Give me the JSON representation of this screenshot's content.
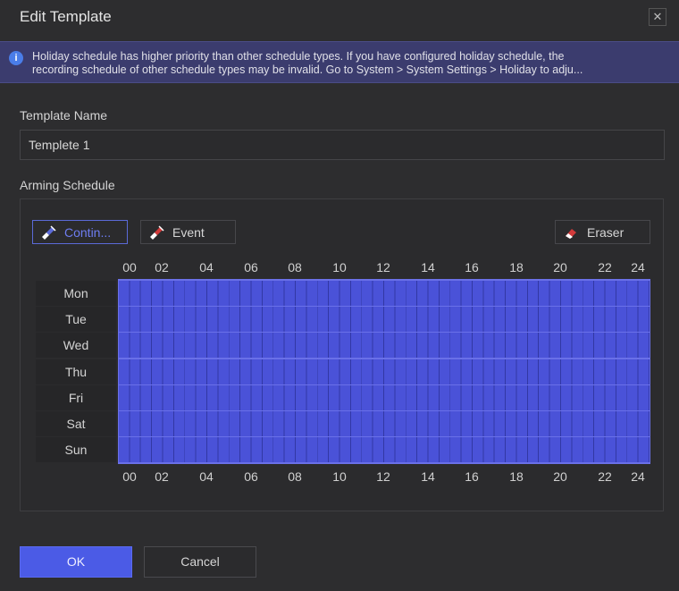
{
  "dialog": {
    "title": "Edit Template",
    "close_glyph": "✕"
  },
  "info": {
    "icon": "i",
    "line1": "Holiday schedule has higher priority than other schedule types. If you have configured holiday schedule, the",
    "line2": "recording schedule of other schedule types may be invalid. Go to System > System Settings > Holiday to adju..."
  },
  "template_name": {
    "label": "Template Name",
    "value": "Templete 1"
  },
  "schedule": {
    "label": "Arming Schedule",
    "tools": {
      "continuous": "Contin...",
      "event": "Event",
      "eraser": "Eraser"
    },
    "hours_top": [
      "00",
      "02",
      "04",
      "06",
      "08",
      "10",
      "12",
      "14",
      "16",
      "18",
      "20",
      "22",
      "24"
    ],
    "hours_bottom": [
      "00",
      "02",
      "04",
      "06",
      "08",
      "10",
      "12",
      "14",
      "16",
      "18",
      "20",
      "22",
      "24"
    ],
    "days": [
      "Mon",
      "Tue",
      "Wed",
      "Thu",
      "Fri",
      "Sat",
      "Sun"
    ],
    "fill_color": "#4a52d8",
    "coverage": "continuous 00-24 all days"
  },
  "footer": {
    "ok": "OK",
    "cancel": "Cancel"
  },
  "colors": {
    "accent": "#4b5be6",
    "banner": "#3b3c6e",
    "background": "#2d2d2f"
  }
}
